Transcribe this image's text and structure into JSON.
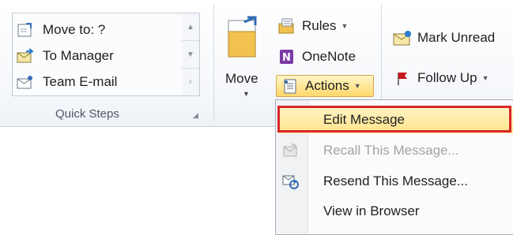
{
  "quick_steps": {
    "items": [
      {
        "label": "Move to: ?",
        "icon": "move-to-icon"
      },
      {
        "label": "To Manager",
        "icon": "to-manager-icon"
      },
      {
        "label": "Team E-mail",
        "icon": "team-email-icon"
      }
    ],
    "group_label": "Quick Steps"
  },
  "move_group": {
    "move_label": "Move",
    "rules_label": "Rules",
    "onenote_label": "OneNote",
    "actions_label": "Actions"
  },
  "tags_group": {
    "mark_unread_label": "Mark Unread",
    "follow_up_label": "Follow Up"
  },
  "actions_menu": {
    "items": [
      {
        "label": "Edit Message",
        "state": "selected"
      },
      {
        "label": "Recall This Message...",
        "state": "disabled"
      },
      {
        "label": "Resend This Message...",
        "state": "normal"
      },
      {
        "label": "View in Browser",
        "state": "normal"
      }
    ]
  },
  "colors": {
    "highlight_border": "#d9262b",
    "hover_fill": "#ffe48a",
    "onenote_purple": "#7a3aa6",
    "flag_red": "#c4161c"
  }
}
